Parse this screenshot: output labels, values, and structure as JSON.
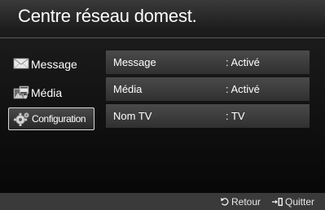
{
  "header": {
    "title": "Centre réseau domest."
  },
  "sidebar": {
    "items": [
      {
        "label": "Message",
        "icon": "envelope-icon",
        "selected": false
      },
      {
        "label": "Média",
        "icon": "media-icon",
        "selected": false
      },
      {
        "label": "Configuration",
        "icon": "gear-icon",
        "selected": true
      }
    ]
  },
  "settings": {
    "rows": [
      {
        "name": "Message",
        "value": ": Activé"
      },
      {
        "name": "Média",
        "value": ": Activé"
      },
      {
        "name": "Nom TV",
        "value": ": TV"
      }
    ]
  },
  "footer": {
    "back": {
      "label": "Retour",
      "icon": "return-icon"
    },
    "exit": {
      "label": "Quitter",
      "icon": "exit-icon"
    }
  },
  "colors": {
    "background": "#050505",
    "row_background": "#3c3c3c",
    "selected_border": "#d8d8d8",
    "text": "#ffffff"
  }
}
